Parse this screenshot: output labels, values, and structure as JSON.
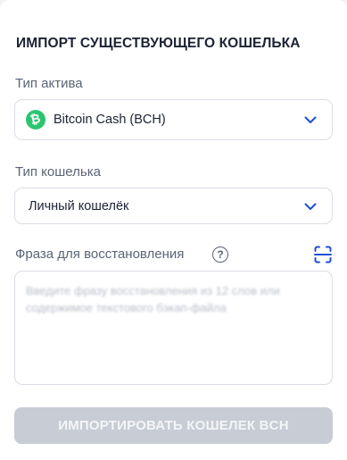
{
  "header": {
    "title": "ИМПОРТ СУЩЕСТВУЮЩЕГО КОШЕЛЬКА"
  },
  "asset_type": {
    "label": "Тип актива",
    "selected": "Bitcoin Cash (BCH)",
    "icon": "bitcoin-cash-icon",
    "icon_color": "#2cc56f"
  },
  "wallet_type": {
    "label": "Тип кошелька",
    "selected": "Личный кошелёк"
  },
  "recovery_phrase": {
    "label": "Фраза для восстановления",
    "help_icon": "question-circle-icon",
    "scan_icon": "scan-icon",
    "scan_icon_color": "#1f4fd1",
    "placeholder": "Введите фразу восстановления из 12 слов или содержимое текстового бэкап-файла",
    "value": ""
  },
  "actions": {
    "import_button": "ИМПОРТИРОВАТЬ КОШЕЛЕК BCH",
    "import_button_color": "#c7ccd5"
  }
}
